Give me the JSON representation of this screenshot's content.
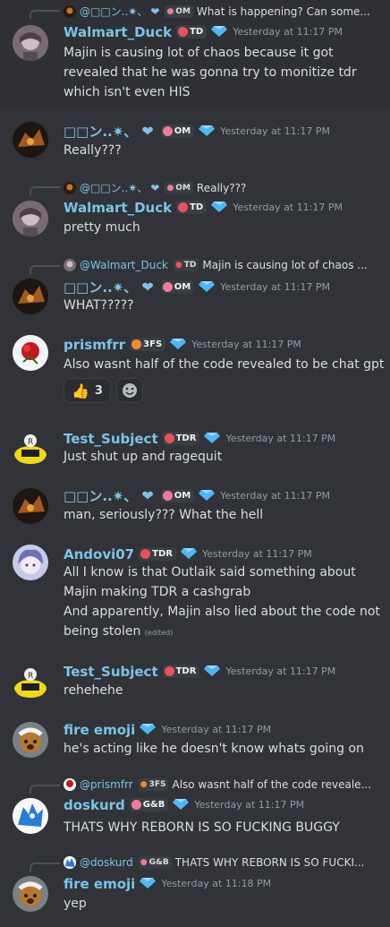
{
  "timestamp": "Yesterday at 11:17 PM",
  "messages": [
    {
      "reply_user": "@□□ン..✷、",
      "reply_badge": "OM",
      "reply_text": "What is happening? Can some...",
      "author": "Walmart_Duck",
      "badge": "TD",
      "time": "Yesterday at 11:17 PM",
      "lines": [
        "Majin is causing  lot of chaos because it got",
        "revealed that he was gonna try to monitize tdr",
        "which isn't even HIS"
      ]
    },
    {
      "author": "□□ン..✷、",
      "badge": "OM",
      "time": "Yesterday at 11:17 PM",
      "lines": [
        "Really???"
      ]
    },
    {
      "reply_user": "@□□ン..✷、",
      "reply_badge": "OM",
      "reply_text": "Really???",
      "author": "Walmart_Duck",
      "badge": "TD",
      "time": "Yesterday at 11:17 PM",
      "lines": [
        "pretty much"
      ]
    },
    {
      "reply_user": "@Walmart_Duck",
      "reply_badge": "TD",
      "reply_text": "Majin is causing  lot of chaos ...",
      "author": "□□ン..✷、",
      "badge": "OM",
      "time": "Yesterday at 11:17 PM",
      "lines": [
        "WHAT?????"
      ]
    },
    {
      "author": "prismfrr",
      "badge": "3FS",
      "time": "Yesterday at 11:17 PM",
      "lines": [
        "Also wasnt half of the code revealed to be chat gpt"
      ],
      "reaction_count": "3"
    },
    {
      "author": "Test_Subject",
      "badge": "TDR",
      "time": "Yesterday at 11:17 PM",
      "lines": [
        "Just shut up and ragequit"
      ]
    },
    {
      "author": "□□ン..✷、",
      "badge": "OM",
      "time": "Yesterday at 11:17 PM",
      "lines": [
        "man, seriously??? What the hell"
      ]
    },
    {
      "author": "Andovi07",
      "badge": "TDR",
      "time": "Yesterday at 11:17 PM",
      "lines": [
        "All I know is that Outlaik said something about",
        "Majin making TDR a cashgrab",
        "And apparently, Majin also lied about the code not",
        "being stolen"
      ],
      "edited": "(edited)"
    },
    {
      "author": "Test_Subject",
      "badge": "TDR",
      "time": "Yesterday at 11:17 PM",
      "lines": [
        "rehehehe"
      ]
    },
    {
      "author": "fire emoji",
      "time": "Yesterday at 11:17 PM",
      "lines": [
        "he's acting like he doesn't know whats going on"
      ]
    },
    {
      "reply_user": "@prismfrr",
      "reply_badge": "3FS",
      "reply_text": "Also wasnt half of the code reveale...",
      "author": "doskurd",
      "badge": "G&B",
      "time": "Yesterday at 11:17 PM",
      "lines": [
        "THATS WHY REBORN IS SO FUCKING BUGGY"
      ]
    },
    {
      "reply_user": "@doskurd",
      "reply_badge": "G&B",
      "reply_text": "THATS WHY REBORN IS SO FUCKI...",
      "author": "fire emoji",
      "time": "Yesterday at 11:18 PM",
      "lines": [
        "yep"
      ]
    }
  ],
  "colors": {
    "walmart": "#3aa0e0",
    "om": "#3aa0e0",
    "prism": "#3aa0e0",
    "test": "#3aa0e0",
    "andovi": "#3aa0e0",
    "fire": "#3aa0e0",
    "doskurd": "#3aa0e0"
  }
}
